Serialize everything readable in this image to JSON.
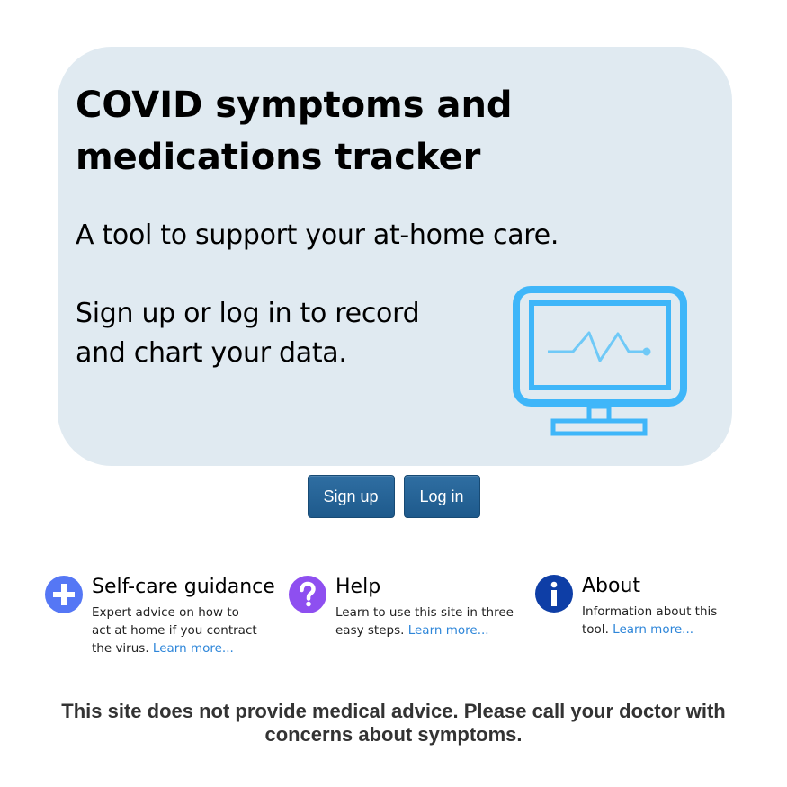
{
  "hero": {
    "title": "COVID symptoms and medications tracker",
    "subtitle": "A tool to support your at-home care.",
    "cta_text": "Sign up or log in to record and chart your data.",
    "illustration_icon": "monitor-heartbeat-icon"
  },
  "buttons": {
    "signup_label": "Sign up",
    "login_label": "Log in"
  },
  "features": [
    {
      "icon": "plus-icon",
      "title": "Self-care guidance",
      "description": "Expert advice on how to act at home if you contract the virus.",
      "link": "Learn more..."
    },
    {
      "icon": "question-icon",
      "title": "Help",
      "description": "Learn to use this site in three easy steps.",
      "link": "Learn more..."
    },
    {
      "icon": "info-icon",
      "title": "About",
      "description": "Information about this tool.",
      "link": "Learn more..."
    }
  ],
  "disclaimer": "This site does not provide medical advice. Please call your doctor with concerns about symptoms.",
  "colors": {
    "hero_bg": "#e0eaf1",
    "button_bg": "#2a6699",
    "monitor": "#3fb6f9",
    "plus_icon": "#5577f5",
    "question_icon": "#8e4ff0",
    "info_icon": "#0e3ea6",
    "link": "#2e86d9"
  }
}
